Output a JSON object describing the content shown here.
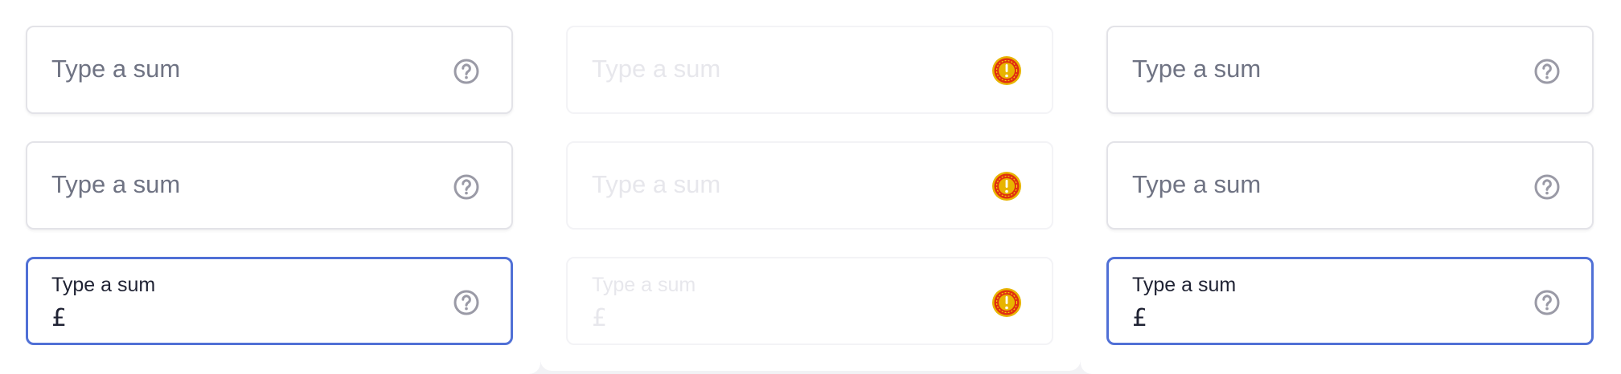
{
  "columns": [
    {
      "state": "default",
      "fields": [
        {
          "placeholder": "Type a sum",
          "icon": "help-circle-icon"
        },
        {
          "placeholder": "Type a sum",
          "icon": "help-circle-icon"
        },
        {
          "label": "Type a sum",
          "value": "£",
          "icon": "help-circle-icon",
          "focused": true
        }
      ]
    },
    {
      "state": "disabled",
      "fields": [
        {
          "placeholder": "Type a sum",
          "icon": "warning-badge-icon"
        },
        {
          "placeholder": "Type a sum",
          "icon": "warning-badge-icon"
        },
        {
          "label": "Type a sum",
          "value": "£",
          "icon": "warning-badge-icon"
        }
      ]
    },
    {
      "state": "default",
      "fields": [
        {
          "placeholder": "Type a sum",
          "icon": "help-circle-icon"
        },
        {
          "placeholder": "Type a sum",
          "icon": "help-circle-icon"
        },
        {
          "label": "Type a sum",
          "value": "£",
          "icon": "help-circle-icon",
          "focused": true
        }
      ]
    }
  ],
  "colors": {
    "focus_border": "#5070d6",
    "border": "#e3e3e8",
    "placeholder_text": "#6f7383",
    "disabled_text": "#e7e7ec",
    "icon_gray": "#9a9aa6",
    "warning_outer": "#e8b400",
    "warning_inner": "#e03010"
  }
}
